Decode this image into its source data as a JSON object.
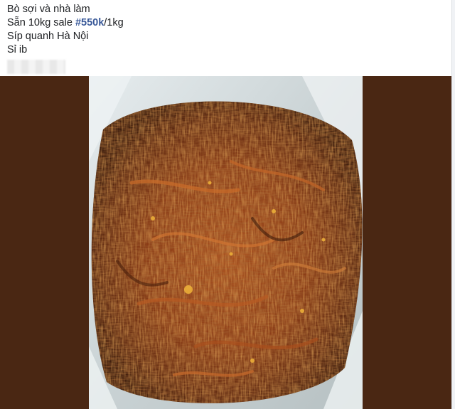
{
  "post": {
    "line1": "Bò sợi và nhà làm",
    "line2_prefix": "Sẵn 10kg sale ",
    "line2_hashtag": "#550k",
    "line2_suffix": "/1kg",
    "line3": "Síp quanh Hà Nội",
    "line4": "Sỉ ib"
  },
  "colors": {
    "media_background": "#4a2713",
    "hashtag": "#385898",
    "text": "#1c1e21"
  }
}
